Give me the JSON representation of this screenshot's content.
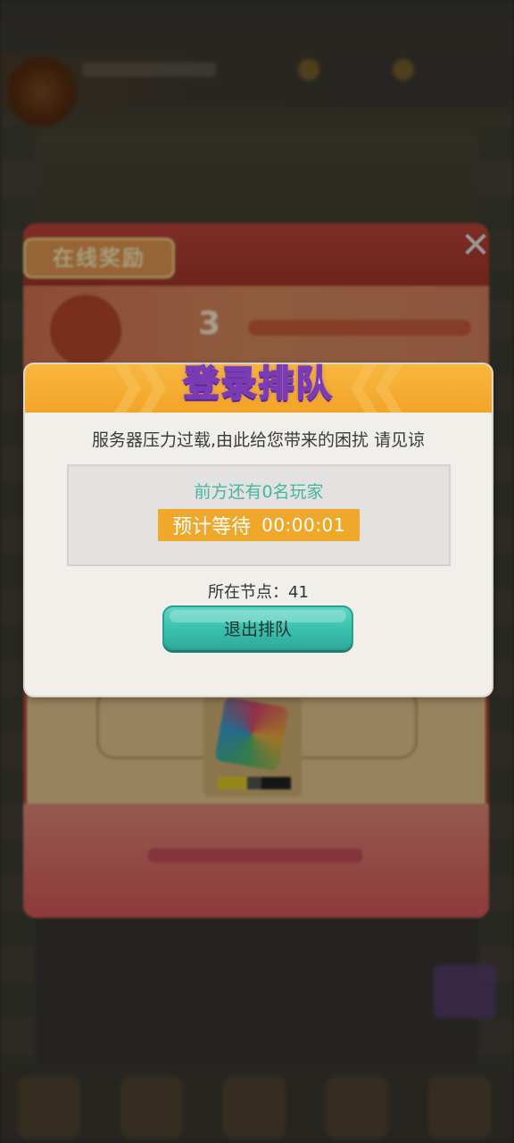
{
  "event_panel": {
    "tag_label": "在线奖励",
    "highlight_number": "3",
    "close_icon": "close-icon"
  },
  "queue_dialog": {
    "title": "登录排队",
    "message": "服务器压力过载,由此给您带来的困扰 请见谅",
    "players_ahead_text": "前方还有0名玩家",
    "wait_label": "预计等待",
    "wait_time": "00:00:01",
    "node_text": "所在节点：41",
    "exit_button_label": "退出排队"
  },
  "colors": {
    "header_orange": "#f3a428",
    "title_outline_purple": "#7a3cb5",
    "teal_text": "#45b5a3",
    "wait_bg": "#f0a82a",
    "exit_button": "#39c0ad",
    "dialog_bg": "#f1efea"
  }
}
